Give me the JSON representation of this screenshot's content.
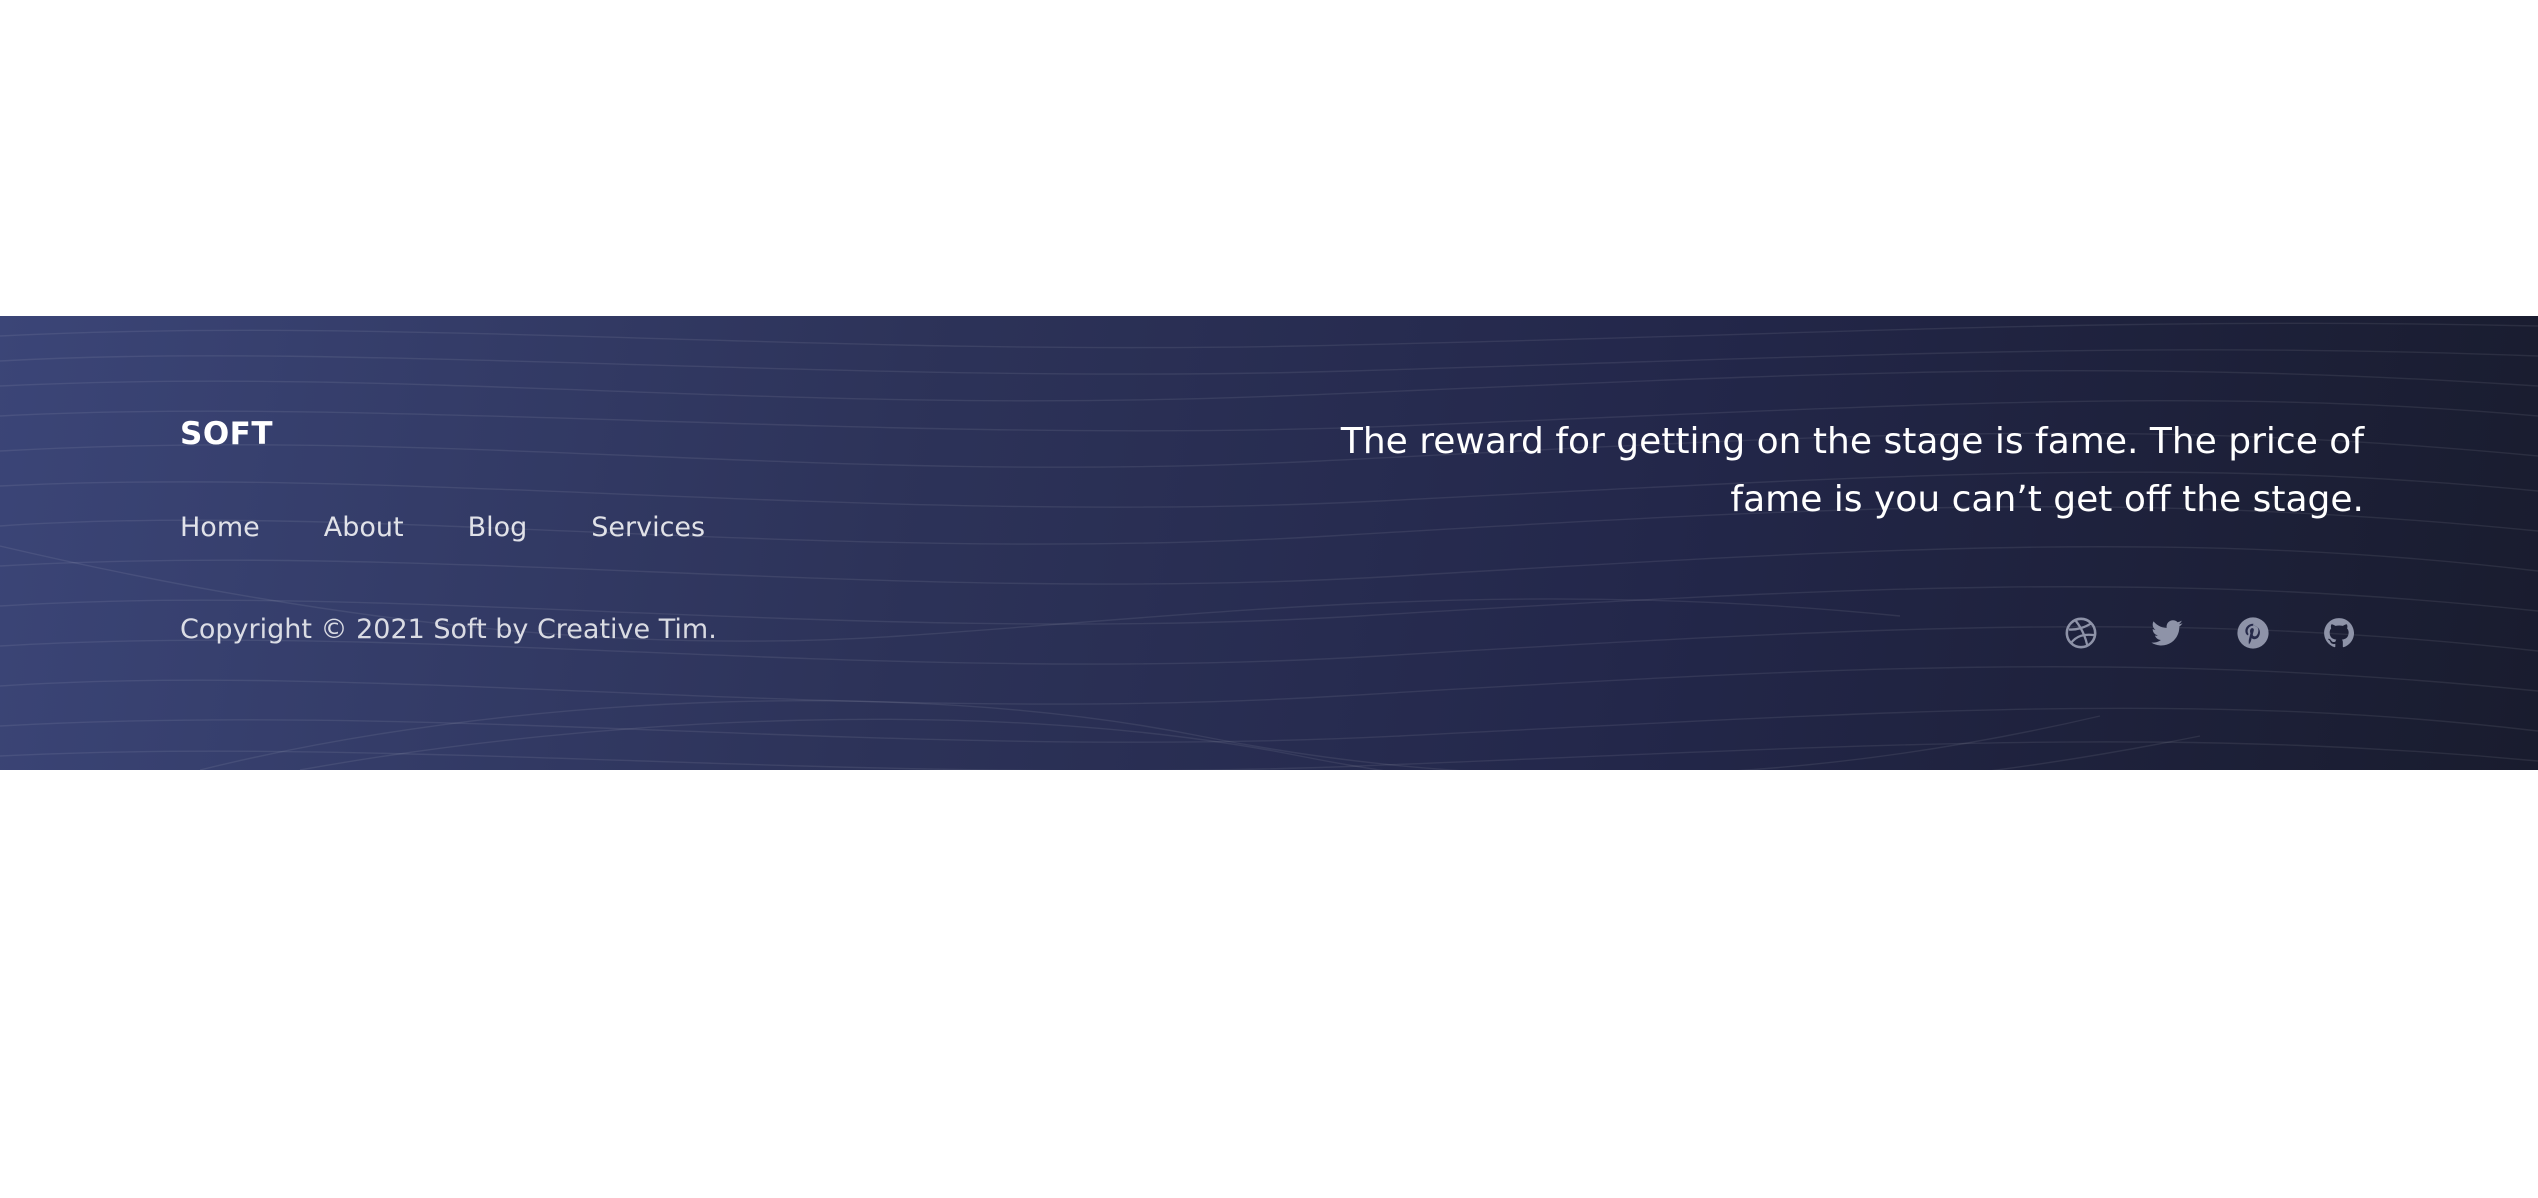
{
  "footer": {
    "brand": "SOFT",
    "nav": {
      "items": [
        {
          "label": "Home"
        },
        {
          "label": "About"
        },
        {
          "label": "Blog"
        },
        {
          "label": "Services"
        }
      ]
    },
    "copyright": "Copyright © 2021 Soft by Creative Tim.",
    "quote": "The reward for getting on the stage is fame. The price of fame is you can’t get off the stage.",
    "social": {
      "icons": [
        "dribbble-icon",
        "twitter-icon",
        "pinterest-icon",
        "github-icon"
      ],
      "icon_color": "#8e93a8"
    },
    "colors": {
      "gradient_start": "#3b4577",
      "gradient_end": "#191c2e",
      "text": "#ffffff"
    }
  }
}
